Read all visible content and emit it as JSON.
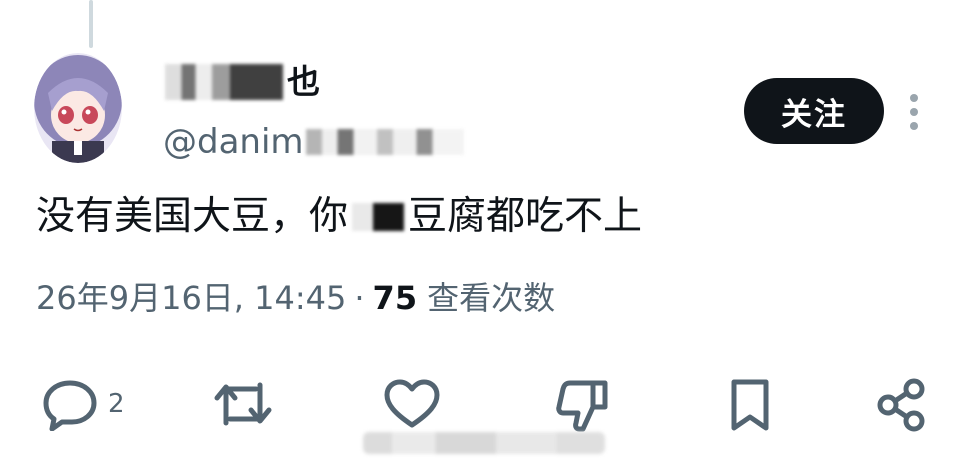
{
  "tweet": {
    "author_name_visible": "也",
    "author_handle_visible": "@danim",
    "follow_label": "关注",
    "text_before": "没有美国大豆，你",
    "text_after": "豆腐都吃不上",
    "timestamp": "26年9月16日, 14:45",
    "separator": "·",
    "views_count": "75",
    "views_label": "查看次数",
    "reply_count": "2"
  },
  "icons": [
    "reply-icon",
    "retweet-icon",
    "like-icon",
    "dislike-icon",
    "bookmark-icon",
    "share-icon",
    "more-icon"
  ],
  "colors": {
    "text": "#0f1419",
    "secondary": "#536471",
    "follow_bg": "#0f1419",
    "follow_text": "#ffffff",
    "thread_line": "#cfd9de"
  }
}
